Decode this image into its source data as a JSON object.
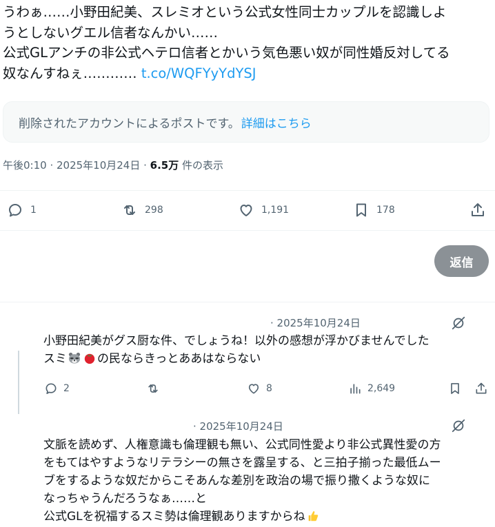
{
  "post": {
    "text_line1": "うわぁ……小野田紀美、スレミオという公式女性同士カップルを認識しよ",
    "text_line2": "うとしないグエル信者なんかい……",
    "text_line3": "公式GLアンチの非公式ヘテロ信者とかいう気色悪い奴が同性婚反対してる",
    "text_line4": "奴なんすねぇ………… ",
    "link": "t.co/WQFYyYdYSJ",
    "deleted_notice": "削除されたアカウントによるポストです。",
    "deleted_more": "詳細はこちら",
    "time": "午後0:10 · 2025年10月24日 · ",
    "views_count": "6.5万",
    "views_label": " 件の表示"
  },
  "actions": {
    "replies": "1",
    "reposts": "298",
    "likes": "1,191",
    "bookmarks": "178"
  },
  "reply_button": "返信",
  "replies": [
    {
      "date": "· 2025年10月24日",
      "line1": "小野田紀美がグス厨な件、でしょうね！以外の感想が浮かびませんでした",
      "line2_pre": "スミ",
      "line2_post": "の民ならきっとああはならない",
      "replies": "2",
      "likes": "8",
      "views": "2,649"
    },
    {
      "date": "· 2025年10月24日",
      "line1": "文脈を読めず、人権意識も倫理観も無い、公式同性愛より非公式異性愛の方",
      "line2": "をもてはやすようなリテラシーの無さを露呈する、と三拍子揃った最低ムー",
      "line3": "ブをするような奴だからこそあんな差別を政治の場で振り撒くような奴に",
      "line4": "なっちゃうんだろうなぁ……と",
      "line5": "公式GLを祝福するスミ勢は倫理観ありますからね"
    }
  ],
  "colors": {
    "accent": "#1d9bf0",
    "muted": "#536471",
    "reply_button": "#8b9196"
  },
  "icons": [
    "reply-icon",
    "repost-icon",
    "like-icon",
    "bookmark-icon",
    "share-icon",
    "grok-icon",
    "views-icon",
    "raccoon-emoji",
    "tomato-emoji",
    "thumbs-up-emoji"
  ]
}
